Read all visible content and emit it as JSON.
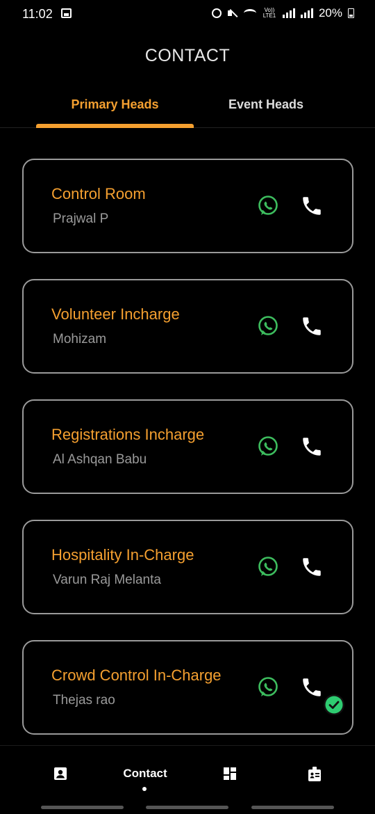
{
  "status_bar": {
    "time": "11:02",
    "battery": "20%",
    "volte_top": "Vo))",
    "volte_bottom": "LTE1"
  },
  "header": {
    "title": "CONTACT"
  },
  "tabs": [
    {
      "label": "Primary Heads",
      "selected": true
    },
    {
      "label": "Event Heads",
      "selected": false
    }
  ],
  "contacts": [
    {
      "role": "Control Room",
      "name": "Prajwal P"
    },
    {
      "role": "Volunteer Incharge",
      "name": "Mohizam"
    },
    {
      "role": "Registrations Incharge",
      "name": "Al Ashqan Babu"
    },
    {
      "role": "Hospitality In-Charge",
      "name": "Varun Raj Melanta"
    },
    {
      "role": "Crowd Control In-Charge",
      "name": "Thejas rao"
    }
  ],
  "bottom_nav": {
    "active_label": "Contact",
    "items": [
      "profile-icon",
      "Contact",
      "dashboard-icon",
      "id-card-icon"
    ]
  },
  "colors": {
    "accent": "#f5a030",
    "whatsapp": "#3dbd5e",
    "card_border": "#9a9a9a",
    "badge": "#2ecc71"
  }
}
